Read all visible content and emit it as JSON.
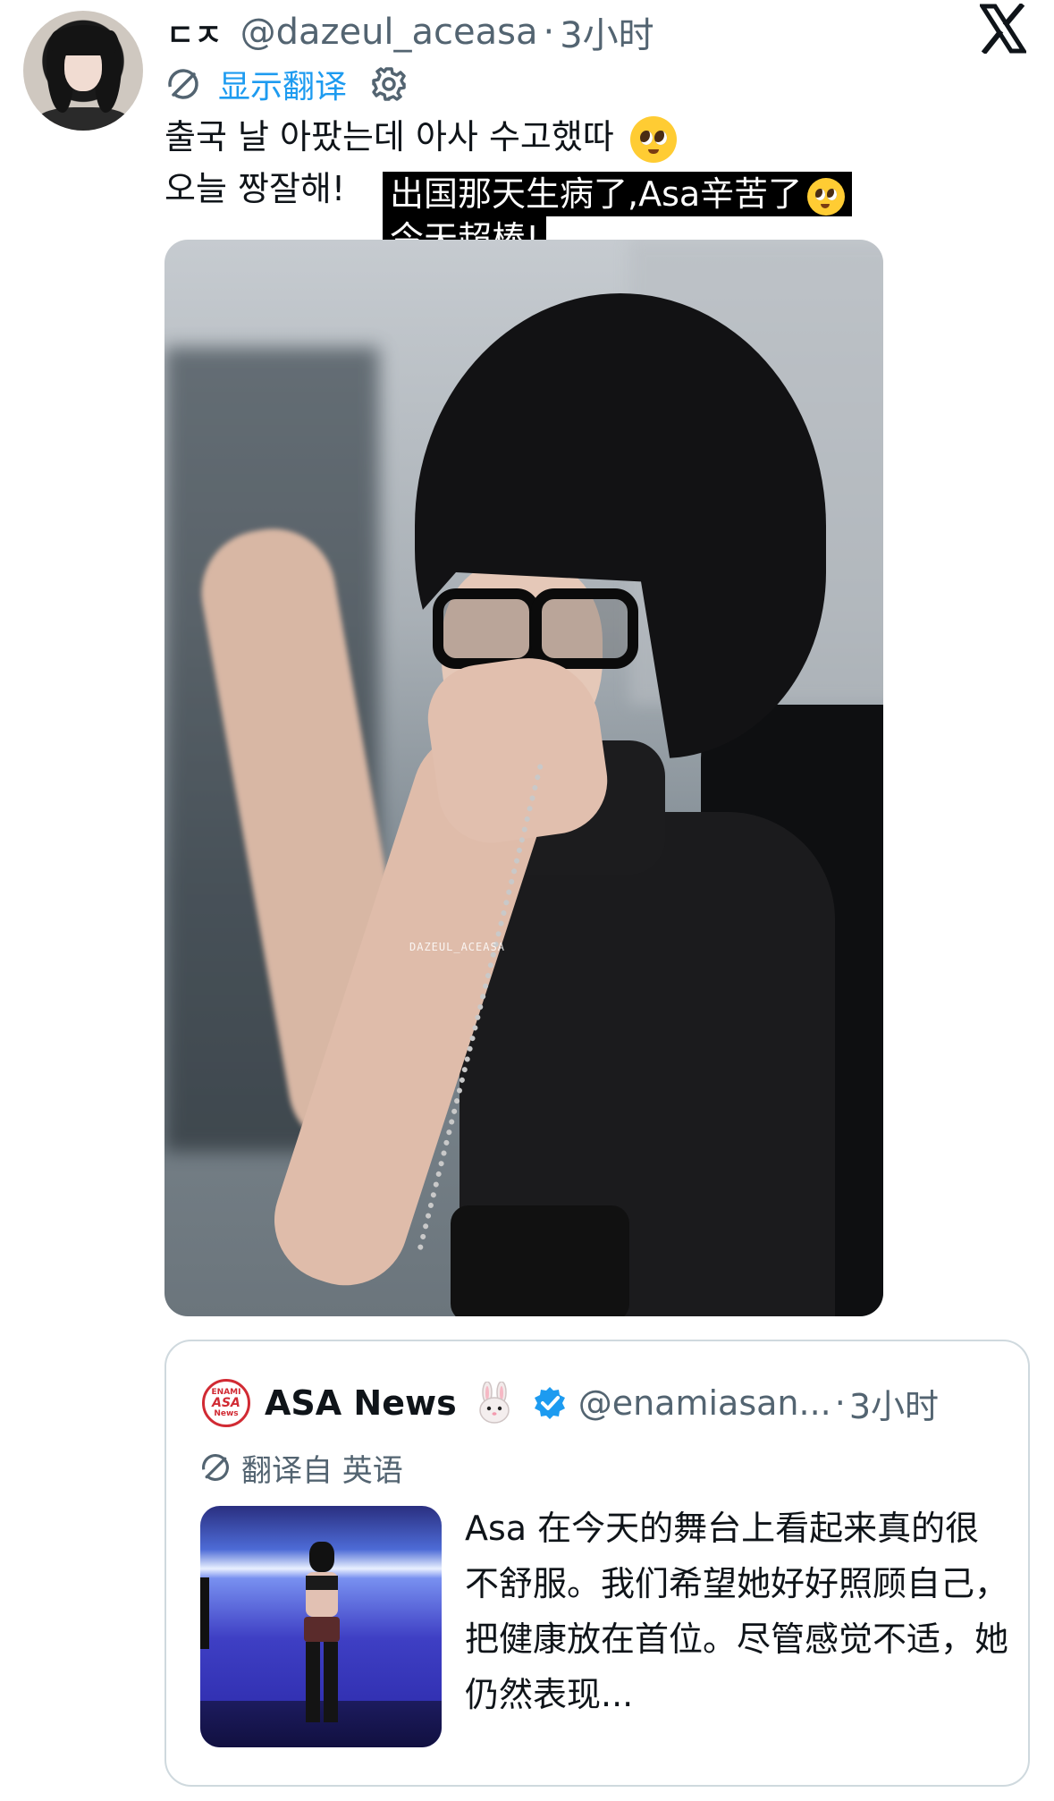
{
  "tweet": {
    "display_name": "ㄷㅈ",
    "handle": "@dazeul_aceasa",
    "separator": "·",
    "time": "3小时",
    "show_translation": "显示翻译",
    "text_line1": "출국 날 아팠는데 아사 수고했따",
    "text_line2": "오늘 짱잘해!",
    "overlay_line1": "出国那天生病了,Asa辛苦了",
    "overlay_line2": "今天超棒!",
    "image_watermark": "DAZEUL_ACEASA"
  },
  "quoted": {
    "display_name": "ASA News",
    "handle": "@enamiasan...",
    "separator": "·",
    "time": "3小时",
    "translated_from": "翻译自 英语",
    "avatar_text": [
      "ENAMI",
      "ASA",
      "News"
    ],
    "text": "Asa 在今天的舞台上看起来真的很不舒服。我们希望她好好照顾自己，把健康放在首位。尽管感觉不适，她仍然表现..."
  },
  "colors": {
    "link_blue": "#1d9bf0",
    "muted_gray": "#536471",
    "verified_blue": "#1d9bf0",
    "text_dark": "#0f1419",
    "border": "#cfd9de"
  },
  "icons": {
    "translate": "translate-icon",
    "settings": "gear-icon",
    "logo": "x-logo-icon",
    "verified": "verified-badge-icon",
    "bunny": "rabbit-emoji-icon",
    "pleading": "pleading-face-emoji"
  }
}
